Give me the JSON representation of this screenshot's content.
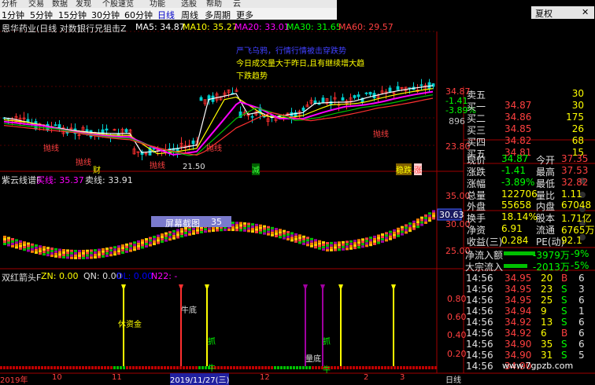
{
  "toolbar": {
    "menu": [
      "分析",
      "交易",
      "数据",
      "发现",
      "个股速览",
      "功能",
      "选股",
      "帮助",
      "云"
    ],
    "periods": [
      "1分钟",
      "5分钟",
      "15分钟",
      "30分钟",
      "60分钟",
      "日线",
      "周线",
      "多周期",
      "更多"
    ],
    "active_period": "日线",
    "restore_label": "夏权",
    "close_label": "✕"
  },
  "main_chart": {
    "title_prefix": "恩华药业(日线 对数)",
    "indicator_name": "银行兄狙击Z",
    "ma5": "MA5: 34.87",
    "ma10": "MA10: 35.27",
    "ma20": "MA20: 33.01",
    "ma30": "MA30: 31.65",
    "ma60": "MA60: 29.57",
    "info_lines": [
      "严飞乌鸦，行情行情被击穿跌势",
      "今日成交量大于昨日,且有继续增大趋",
      "下跌趋势"
    ],
    "labels": [
      "抛线",
      "抛线",
      "抛线",
      "抛线",
      "抛线",
      "财",
      "21.50",
      "减",
      "稳跌",
      "涨"
    ],
    "price_ticks": [
      "34.87",
      "23.80"
    ],
    "small_values": [
      "-1.41",
      "-3.89%",
      "896"
    ]
  },
  "sub1": {
    "title": "紫云线谱F",
    "buy": "买线: 35.37",
    "sell": "卖线: 33.91",
    "screenshot_label": "屏幕截图",
    "screenshot_value": "35",
    "ticks": [
      "35.00",
      "30.00",
      "25.00"
    ],
    "price_marker": "30.63"
  },
  "sub2": {
    "title": "双红箭头F",
    "zn": "ZN: 0.00",
    "qn": "QN: 0.00",
    "dl": "DL: 0.00",
    "n22": "N22: -",
    "labels": [
      "休资金",
      "牛底",
      "抓",
      "牛",
      "量底",
      "抓",
      "牛"
    ],
    "ticks": [
      "0.80",
      "0.60",
      "0.40",
      "0.20"
    ]
  },
  "xaxis": {
    "labels": [
      "2019年",
      "10",
      "11",
      "2019/11/27(三)",
      "12",
      "2",
      "3"
    ],
    "period_label": "日线"
  },
  "order_book": {
    "sells": [
      {
        "label": "卖五",
        "price": "",
        "vol": "30"
      },
      {
        "label": "买一",
        "price": "34.87",
        "vol": "30"
      },
      {
        "label": "买二",
        "price": "34.86",
        "vol": "175"
      },
      {
        "label": "买三",
        "price": "34.85",
        "vol": "26"
      },
      {
        "label": "买四",
        "price": "34.82",
        "vol": "68"
      },
      {
        "label": "买五",
        "price": "34.81",
        "vol": "15"
      }
    ]
  },
  "quote": {
    "rows": [
      {
        "l1": "现价",
        "v1": "34.87",
        "l2": "今开",
        "v2": "37.35"
      },
      {
        "l1": "涨跌",
        "v1": "-1.41",
        "l2": "最高",
        "v2": "37.53"
      },
      {
        "l1": "涨幅",
        "v1": "-3.89%",
        "l2": "最低",
        "v2": "32.82"
      },
      {
        "l1": "总量",
        "v1": "122706",
        "l2": "量比",
        "v2": "1.11"
      },
      {
        "l1": "外盘",
        "v1": "55658",
        "l2": "内盘",
        "v2": "67048"
      },
      {
        "l1": "换手",
        "v1": "18.14%",
        "l2": "股本",
        "v2": "1.71亿"
      },
      {
        "l1": "净资",
        "v1": "6.91",
        "l2": "流通",
        "v2": "6765万"
      },
      {
        "l1": "收益(三)",
        "v1": "0.284",
        "l2": "PE(动)",
        "v2": "92.1"
      }
    ],
    "flows": [
      {
        "label": "净流入额",
        "value": "-3979万",
        "pct": "-9%"
      },
      {
        "label": "大宗流入",
        "value": "-2013万",
        "pct": "-5%"
      }
    ]
  },
  "trades": [
    {
      "time": "14:56",
      "price": "34.95",
      "vol": "20",
      "dir": "B",
      "n": "6"
    },
    {
      "time": "14:56",
      "price": "34.95",
      "vol": "23",
      "dir": "S",
      "n": "3"
    },
    {
      "time": "14:56",
      "price": "34.95",
      "vol": "25",
      "dir": "S",
      "n": "6"
    },
    {
      "time": "14:56",
      "price": "34.94",
      "vol": "9",
      "dir": "S",
      "n": "1"
    },
    {
      "time": "14:56",
      "price": "34.92",
      "vol": "13",
      "dir": "S",
      "n": "6"
    },
    {
      "time": "14:56",
      "price": "34.92",
      "vol": "6",
      "dir": "B",
      "n": "6"
    },
    {
      "time": "14:56",
      "price": "34.90",
      "vol": "35",
      "dir": "S",
      "n": "6"
    },
    {
      "time": "14:56",
      "price": "34.90",
      "vol": "31",
      "dir": "S",
      "n": "5"
    },
    {
      "time": "14:56",
      "price": "34.90",
      "vol": "",
      "dir": "",
      "n": ""
    }
  ],
  "watermark": "www.7gpzb.com",
  "colors": {
    "up": "#ff3030",
    "down": "#00c8c8",
    "yellow": "#ffff00",
    "magenta": "#ff00ff",
    "green": "#00c000",
    "white": "#e0e0e0"
  }
}
